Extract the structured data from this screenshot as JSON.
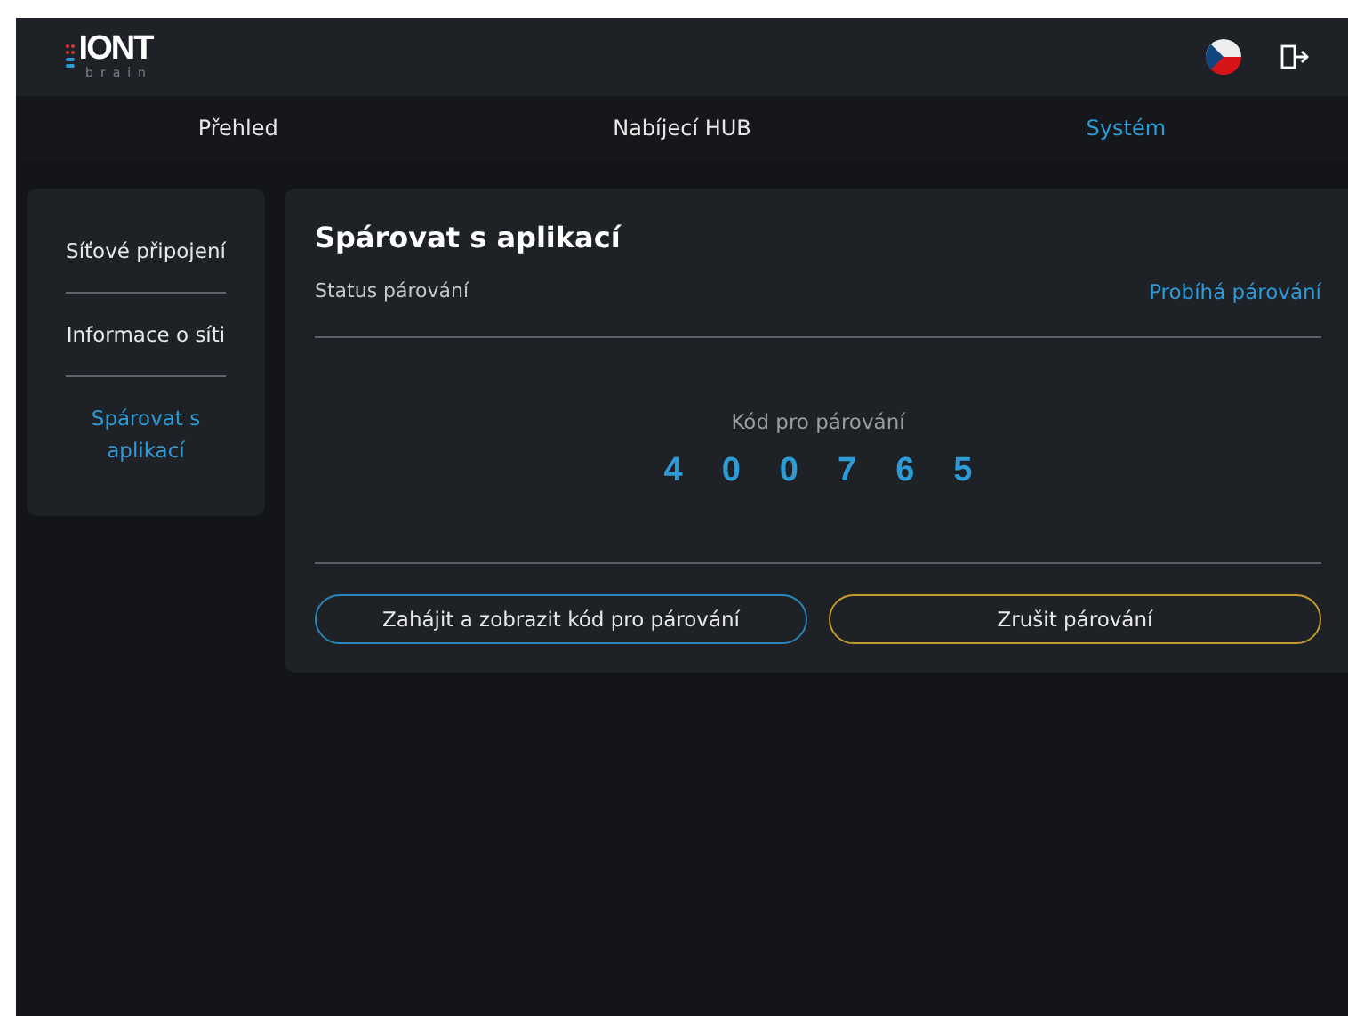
{
  "logo": {
    "name": "IONT",
    "subtitle": "brain"
  },
  "nav": [
    {
      "label": "Přehled",
      "selected": false
    },
    {
      "label": "Nabíjecí HUB",
      "selected": false
    },
    {
      "label": "Systém",
      "selected": true
    }
  ],
  "sidebar": {
    "items": [
      {
        "label": "Síťové připojení",
        "selected": false
      },
      {
        "label": "Informace o síti",
        "selected": false
      },
      {
        "label": "Spárovat s aplikací",
        "selected": true
      }
    ]
  },
  "panel": {
    "title": "Spárovat s aplikací",
    "status_label": "Status párování",
    "status_value": "Probíhá párování",
    "code_label": "Kód pro párování",
    "code_digits": [
      "4",
      "0",
      "0",
      "7",
      "6",
      "5"
    ],
    "buttons": [
      {
        "label": "Zahájit a zobrazit kód pro párování",
        "kind": "primary"
      },
      {
        "label": "Zrušit párování",
        "kind": "warning"
      }
    ]
  }
}
